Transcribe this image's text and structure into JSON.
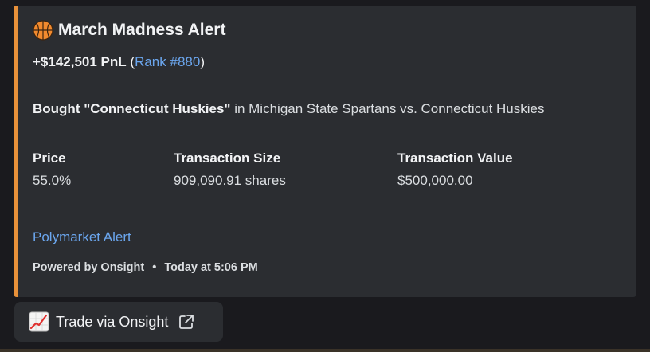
{
  "embed": {
    "accent_color": "#e8913a",
    "title_icon": "basketball-icon",
    "title": "March Madness Alert",
    "pnl": "+$142,501 PnL",
    "rank_open": "(",
    "rank_link": "Rank #880",
    "rank_close": ")",
    "description": {
      "bold": "Bought \"Connecticut Huskies\"",
      "rest": " in Michigan State Spartans vs. Connecticut Huskies"
    },
    "fields": [
      {
        "name": "Price",
        "value": "55.0%"
      },
      {
        "name": "Transaction Size",
        "value": "909,090.91 shares"
      },
      {
        "name": "Transaction Value",
        "value": "$500,000.00"
      }
    ],
    "footer_link": "Polymarket Alert",
    "footer_powered": "Powered by Onsight",
    "footer_separator": "•",
    "footer_time": "Today at 5:06 PM"
  },
  "button": {
    "icon": "chart-increasing-icon",
    "label": "Trade via Onsight",
    "trailing_icon": "external-link-icon"
  },
  "colors": {
    "link": "#6ba6ee",
    "embed_bg": "#2b2d31",
    "page_bg": "#1a1a1e"
  }
}
